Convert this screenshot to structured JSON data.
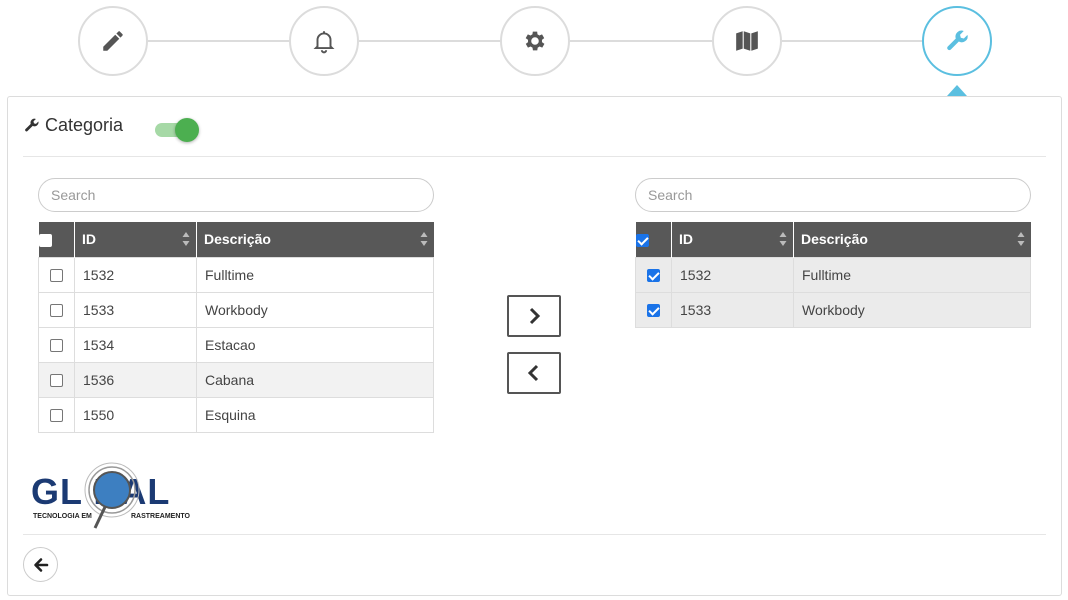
{
  "steps": [
    {
      "icon": "pencil-icon"
    },
    {
      "icon": "bell-icon"
    },
    {
      "icon": "gear-icon"
    },
    {
      "icon": "map-icon"
    },
    {
      "icon": "wrench-icon",
      "active": true
    }
  ],
  "colors": {
    "active_step": "#5bbfe0",
    "table_header": "#585858",
    "toggle_on": "#4caf50",
    "logo_blue": "#1b3a73"
  },
  "header": {
    "title": "Categoria",
    "toggle_on": true
  },
  "left": {
    "search_placeholder": "Search",
    "columns": [
      "ID",
      "Descrição"
    ],
    "rows": [
      {
        "id": "1532",
        "desc": "Fulltime"
      },
      {
        "id": "1533",
        "desc": "Workbody"
      },
      {
        "id": "1534",
        "desc": "Estacao"
      },
      {
        "id": "1536",
        "desc": "Cabana"
      },
      {
        "id": "1550",
        "desc": "Esquina"
      }
    ]
  },
  "right": {
    "search_placeholder": "Search",
    "columns": [
      "ID",
      "Descrição"
    ],
    "rows": [
      {
        "id": "1532",
        "desc": "Fulltime"
      },
      {
        "id": "1533",
        "desc": "Workbody"
      }
    ]
  },
  "actions": {
    "move_right_icon": "chevron-right-icon",
    "move_left_icon": "chevron-left-icon",
    "back_icon": "arrow-left-icon"
  },
  "logo": {
    "main": "GLOBAL",
    "tagline_left": "TECNOLOGIA EM",
    "tagline_right": "RASTREAMENTO"
  }
}
